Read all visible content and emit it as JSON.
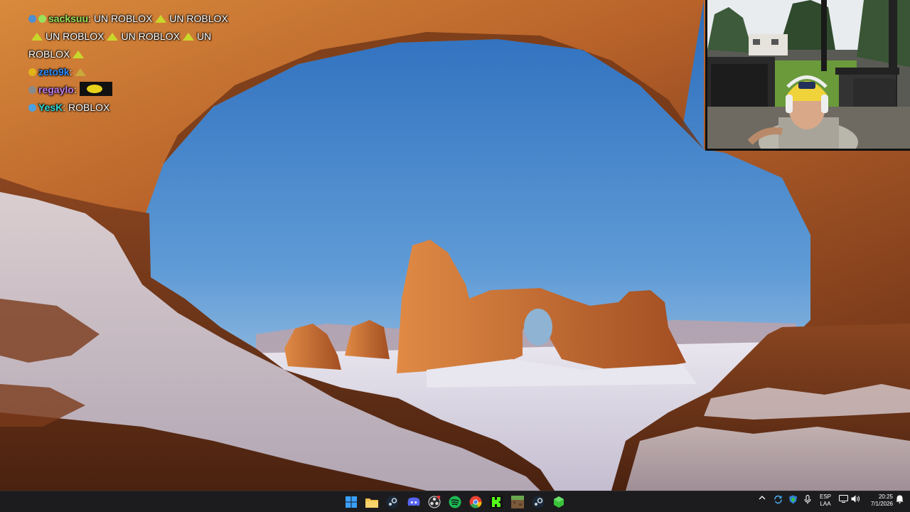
{
  "chat": {
    "messages": [
      {
        "user": "sacksuu",
        "user_color": "#9be05b",
        "badge_color": "#4d8fd1",
        "parts": [
          "UN ROBLOX",
          "UN ROBLOX",
          "UN ROBLOX",
          "UN ROBLOX",
          "UN",
          "ROBLOX"
        ]
      },
      {
        "user": "zeto9k",
        "user_color": "#2d8cff",
        "badge_color": "#e2b21b"
      },
      {
        "user": "regaylo",
        "user_color": "#c07be8",
        "badge_color": "#8a8a8a"
      },
      {
        "user": "YesK",
        "user_color": "#30d4cf",
        "badge_color": "#4da0e0",
        "text": "ROBLOX"
      }
    ]
  },
  "taskbar": {
    "apps": [
      {
        "name": "windows-start",
        "color": "#3aa0ff"
      },
      {
        "name": "file-explorer",
        "color": "#f2c14e"
      },
      {
        "name": "steam",
        "color": "#c7d5e0"
      },
      {
        "name": "discord",
        "color": "#5865f2"
      },
      {
        "name": "obs",
        "color": "#cccccc"
      },
      {
        "name": "spotify",
        "color": "#1db954"
      },
      {
        "name": "chrome",
        "color": "#ea4335"
      },
      {
        "name": "kick",
        "color": "#53fc18"
      },
      {
        "name": "minecraft",
        "color": "#7a9a3a"
      },
      {
        "name": "steam-2",
        "color": "#c7d5e0"
      },
      {
        "name": "game-app",
        "color": "#3ac23a"
      }
    ],
    "tray": {
      "language_line1": "ESP",
      "language_line2": "LAA",
      "time": "20:25",
      "date": "7/1/2026"
    }
  }
}
